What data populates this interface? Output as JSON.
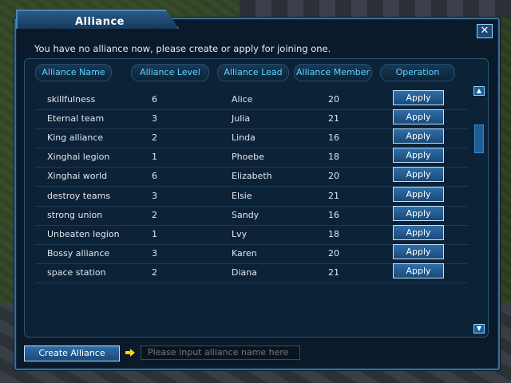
{
  "window": {
    "title": "Alliance"
  },
  "notice": "You have no alliance now, please create or apply for joining one.",
  "columns": [
    "Alliance Name",
    "Alliance Level",
    "Alliance Lead",
    "Alliance Member",
    "Operation"
  ],
  "rows": [
    {
      "name": "skillfulness",
      "level": "6",
      "lead": "Alice",
      "members": "20",
      "action": "Apply"
    },
    {
      "name": "Eternal team",
      "level": "3",
      "lead": "Julia",
      "members": "21",
      "action": "Apply"
    },
    {
      "name": "King alliance",
      "level": "2",
      "lead": "Linda",
      "members": "16",
      "action": "Apply"
    },
    {
      "name": "Xinghai legion",
      "level": "1",
      "lead": "Phoebe",
      "members": "18",
      "action": "Apply"
    },
    {
      "name": "Xinghai world",
      "level": "6",
      "lead": "Elizabeth",
      "members": "20",
      "action": "Apply"
    },
    {
      "name": "destroy teams",
      "level": "3",
      "lead": "Elsie",
      "members": "21",
      "action": "Apply"
    },
    {
      "name": "strong union",
      "level": "2",
      "lead": "Sandy",
      "members": "16",
      "action": "Apply"
    },
    {
      "name": "Unbeaten legion",
      "level": "1",
      "lead": "Lvy",
      "members": "18",
      "action": "Apply"
    },
    {
      "name": "Bossy alliance",
      "level": "3",
      "lead": "Karen",
      "members": "20",
      "action": "Apply"
    },
    {
      "name": "space station",
      "level": "2",
      "lead": "Diana",
      "members": "21",
      "action": "Apply"
    }
  ],
  "footer": {
    "create_label": "Create Alliance",
    "input_placeholder": "Please input alliance name here"
  },
  "icons": {
    "close": "close-icon",
    "arrow": "arrow-right-icon",
    "scroll_up": "scroll-up-icon",
    "scroll_down": "scroll-down-icon"
  },
  "colors": {
    "accent": "#5fd3ff",
    "button": "#2f6ea8"
  }
}
